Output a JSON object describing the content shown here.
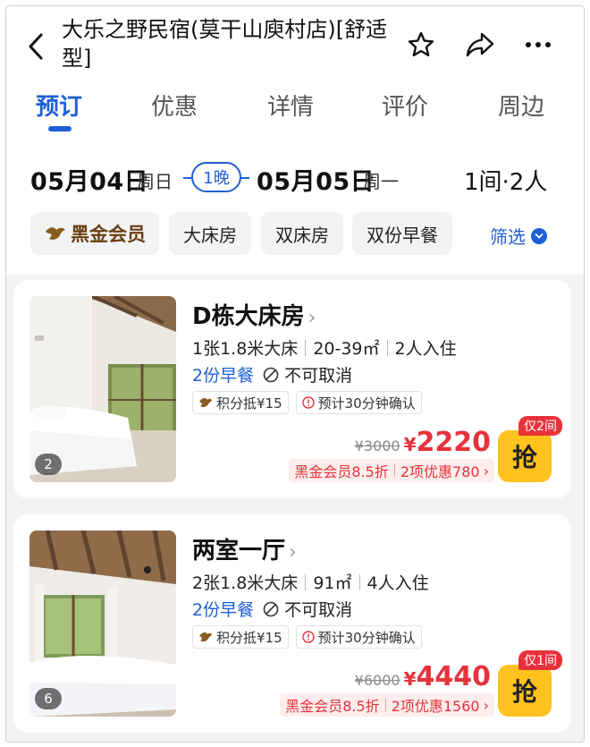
{
  "header": {
    "title": "大乐之野民宿(莫干山庾村店)[舒适型]"
  },
  "tabs": [
    "预订",
    "优惠",
    "详情",
    "评价",
    "周边"
  ],
  "dates": {
    "checkin_date": "05月04日",
    "checkin_weekday": "周日",
    "nights": "1晚",
    "checkout_date": "05月05日",
    "checkout_weekday": "周一",
    "rooms_guests": "1间·2人"
  },
  "filters": {
    "member": "黑金会员",
    "chips": [
      "大床房",
      "双床房",
      "双份早餐"
    ],
    "filter_label": "筛选"
  },
  "rooms": [
    {
      "name": "D栋大床房",
      "photo_count": "2",
      "bed": "1张1.8米大床",
      "area": "20-39㎡",
      "occupancy": "2人入住",
      "breakfast": "2份早餐",
      "cancel": "不可取消",
      "tag_points": "积分抵¥15",
      "tag_confirm": "预计30分钟确认",
      "original_price": "¥3000",
      "currency": "¥",
      "price": "2220",
      "member_discount": "黑金会员8.5折",
      "promo": "2项优惠780",
      "badge": "仅2间",
      "book_label": "抢"
    },
    {
      "name": "两室一厅",
      "photo_count": "6",
      "bed": "2张1.8米大床",
      "area": "91㎡",
      "occupancy": "4人入住",
      "breakfast": "2份早餐",
      "cancel": "不可取消",
      "tag_points": "积分抵¥15",
      "tag_confirm": "预计30分钟确认",
      "original_price": "¥6000",
      "currency": "¥",
      "price": "4440",
      "member_discount": "黑金会员8.5折",
      "promo": "2项优惠1560",
      "badge": "仅1间",
      "book_label": "抢"
    }
  ],
  "colors": {
    "accent": "#1f5fd6",
    "price_red": "#e8323b",
    "grab_yellow": "#ffc21e",
    "member_brown": "#6b3f12"
  },
  "icons": [
    "back-icon",
    "star-icon",
    "share-icon",
    "more-icon",
    "chevron-right-icon",
    "no-entry-icon",
    "coin-icon",
    "clock-alert-icon",
    "chevron-down-icon"
  ]
}
